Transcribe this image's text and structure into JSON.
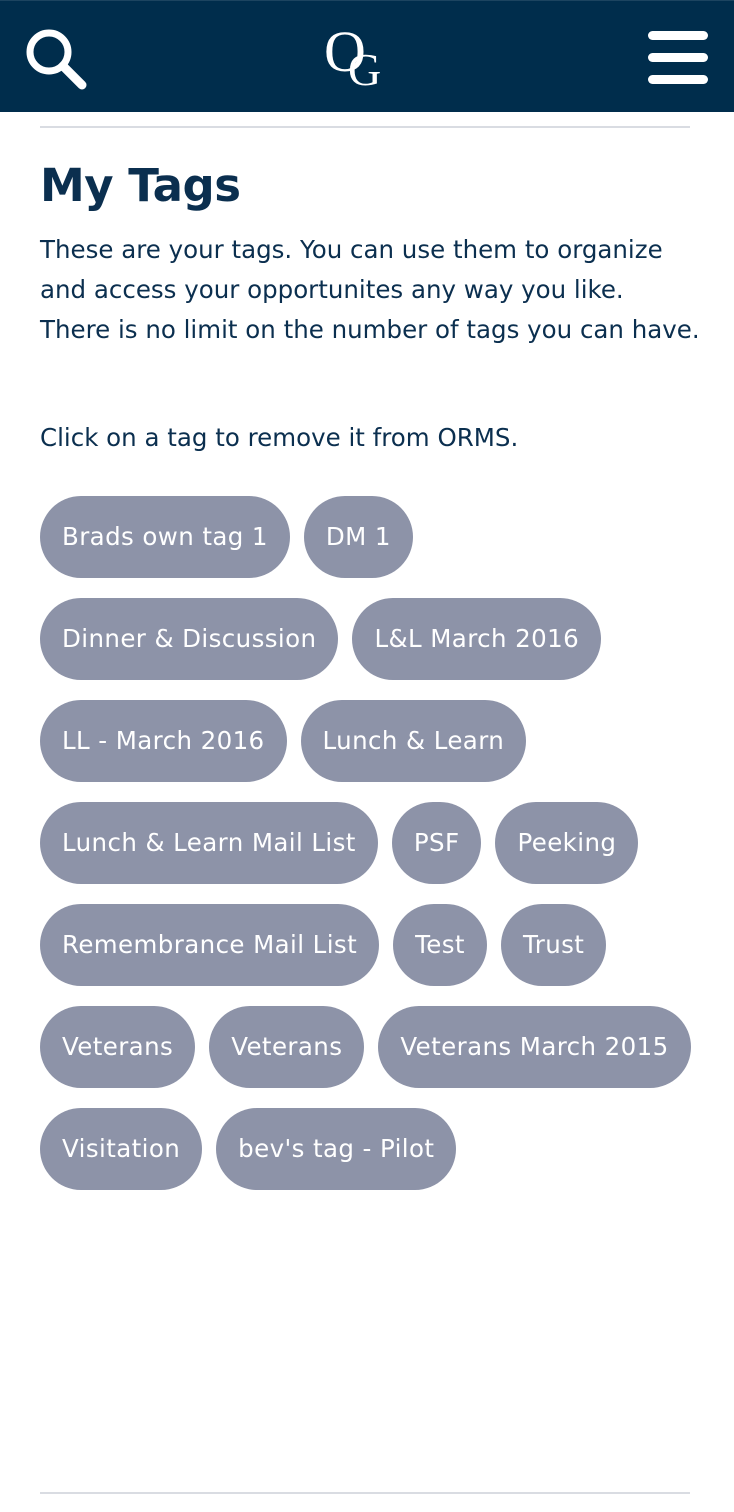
{
  "header": {
    "search_icon": "search-icon",
    "logo_text": "OG",
    "menu_icon": "hamburger-menu-icon",
    "background_color": "#002d4c"
  },
  "main": {
    "title": "My Tags",
    "intro": "These are your tags. You can use them to organize and access your opportunites any way you like. There is no limit on the number of tags you can have.",
    "hint": "Click on a tag to remove it from ORMS.",
    "tag_color": "#8d93a8",
    "tags": [
      "Brads own tag 1",
      "DM 1",
      "Dinner & Discussion",
      "L&L March 2016",
      "LL - March 2016",
      "Lunch & Learn",
      "Lunch & Learn Mail List",
      "PSF",
      "Peeking",
      "Remembrance Mail List",
      "Test",
      "Trust",
      "Veterans",
      "Veterans",
      "Veterans March 2015",
      "Visitation",
      "bev's tag - Pilot"
    ]
  }
}
